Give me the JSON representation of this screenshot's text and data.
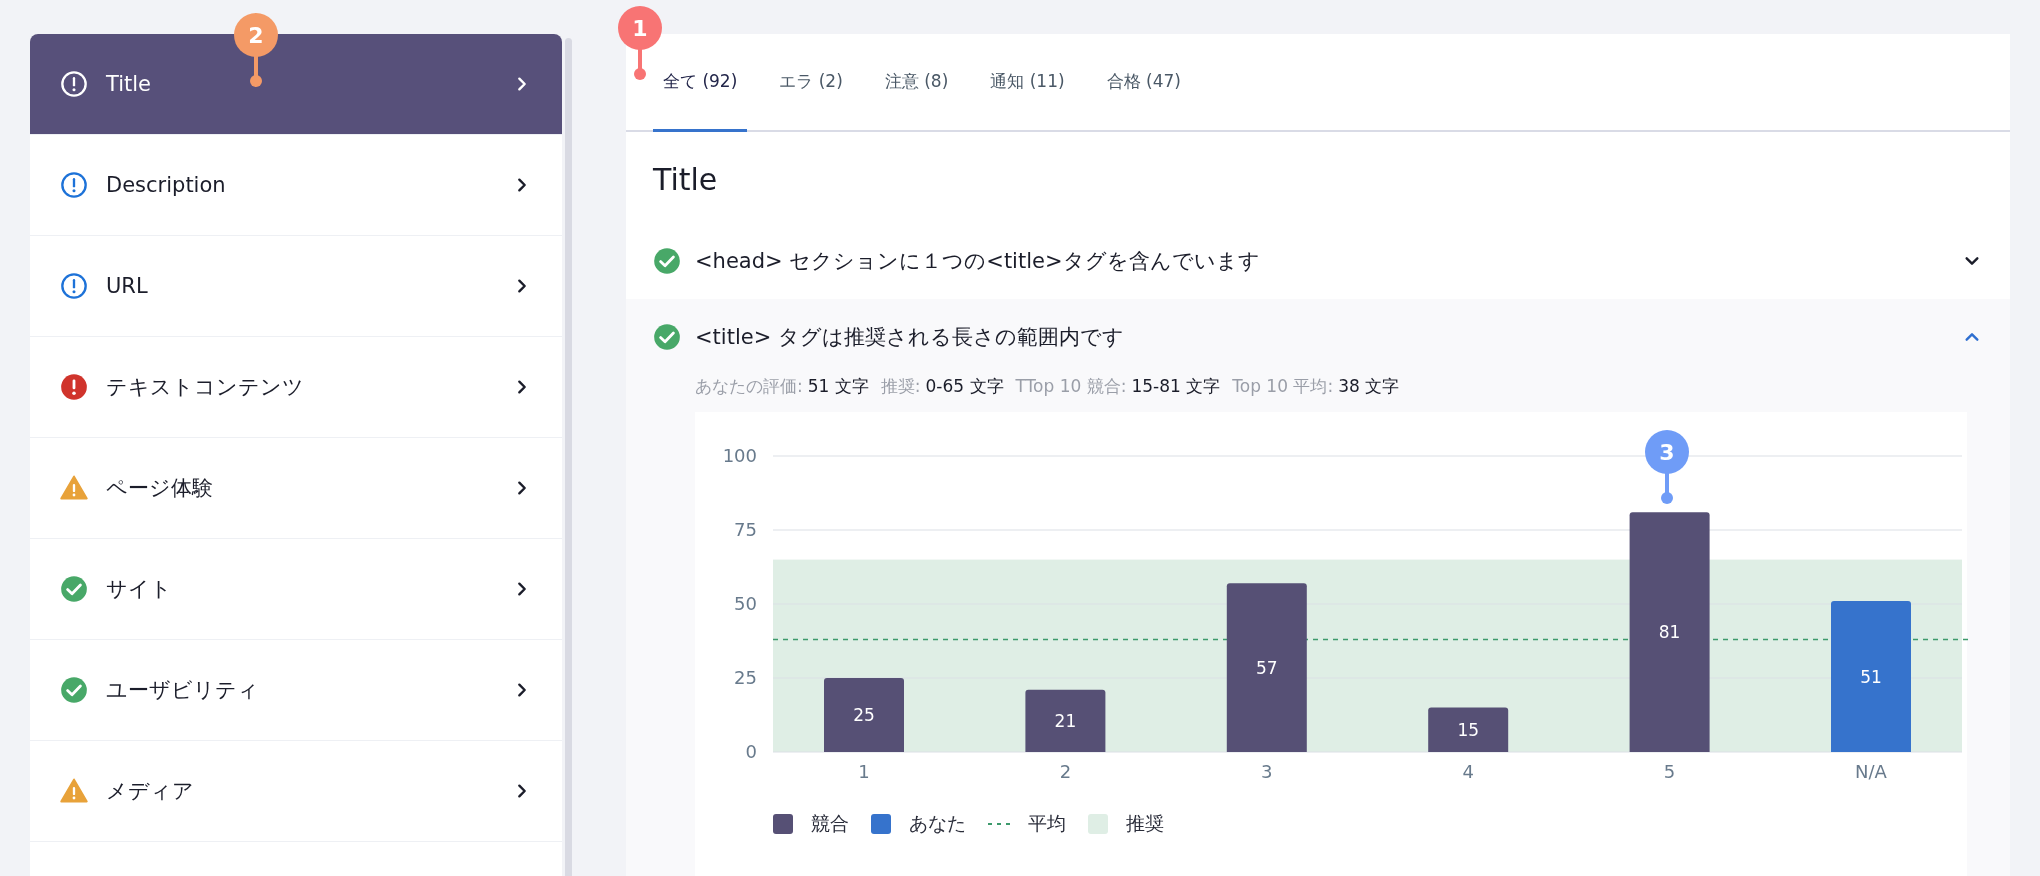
{
  "sidebar": {
    "items": [
      {
        "label": "Title",
        "kind": "info",
        "selected": true
      },
      {
        "label": "Description",
        "kind": "info",
        "selected": false
      },
      {
        "label": "URL",
        "kind": "info",
        "selected": false
      },
      {
        "label": "テキストコンテンツ",
        "kind": "error",
        "selected": false
      },
      {
        "label": "ページ体験",
        "kind": "warning",
        "selected": false
      },
      {
        "label": "サイト",
        "kind": "pass",
        "selected": false
      },
      {
        "label": "ユーザビリティ",
        "kind": "pass",
        "selected": false
      },
      {
        "label": "メディア",
        "kind": "warning",
        "selected": false
      }
    ]
  },
  "tabs": [
    {
      "label": "全て (92)",
      "selected": true
    },
    {
      "label": "エラ (2)",
      "selected": false
    },
    {
      "label": "注意 (8)",
      "selected": false
    },
    {
      "label": "通知 (11)",
      "selected": false
    },
    {
      "label": "合格 (47)",
      "selected": false
    }
  ],
  "section": {
    "title": "Title",
    "checks": [
      {
        "kind": "pass",
        "title": "<head> セクションに１つの<title>タグを含んでいます",
        "expanded": false
      },
      {
        "kind": "pass",
        "title": "<title> タグは推奨される長さの範囲内です",
        "expanded": true,
        "metrics": [
          {
            "label": "あなたの評価:",
            "value": "51 文字"
          },
          {
            "label": "推奨:",
            "value": "0-65 文字"
          },
          {
            "label": "TTop 10 競合:",
            "value": "15-81 文字"
          },
          {
            "label": "Top 10 平均:",
            "value": "38 文字"
          }
        ],
        "chart_data": {
          "type": "bar",
          "stacked": true,
          "categories": [
            "1",
            "2",
            "3",
            "4",
            "5",
            "N/A"
          ],
          "series": [
            {
              "name": "競合",
              "color": "#565075",
              "values": [
                25,
                21,
                57,
                15,
                81,
                null
              ]
            },
            {
              "name": "あなた",
              "color": "#3673cc",
              "values": [
                null,
                null,
                null,
                null,
                null,
                51
              ]
            }
          ],
          "ylim": [
            0,
            100
          ],
          "yticks": [
            0,
            25,
            50,
            75,
            100
          ],
          "data_labels": true,
          "grid": true,
          "legend": true,
          "ref_lines": [
            {
              "axis": "y",
              "value": 38,
              "label": "平均",
              "color": "#3d9a6c"
            }
          ],
          "bands": [
            {
              "axis": "y",
              "from": 0,
              "to": 65,
              "label": "推奨",
              "color": "#dfeee5"
            }
          ]
        }
      }
    ]
  },
  "callouts": [
    {
      "number": "1",
      "color": "#f87474"
    },
    {
      "number": "2",
      "color": "#f49a66"
    },
    {
      "number": "3",
      "color": "#6f9cf7"
    }
  ]
}
